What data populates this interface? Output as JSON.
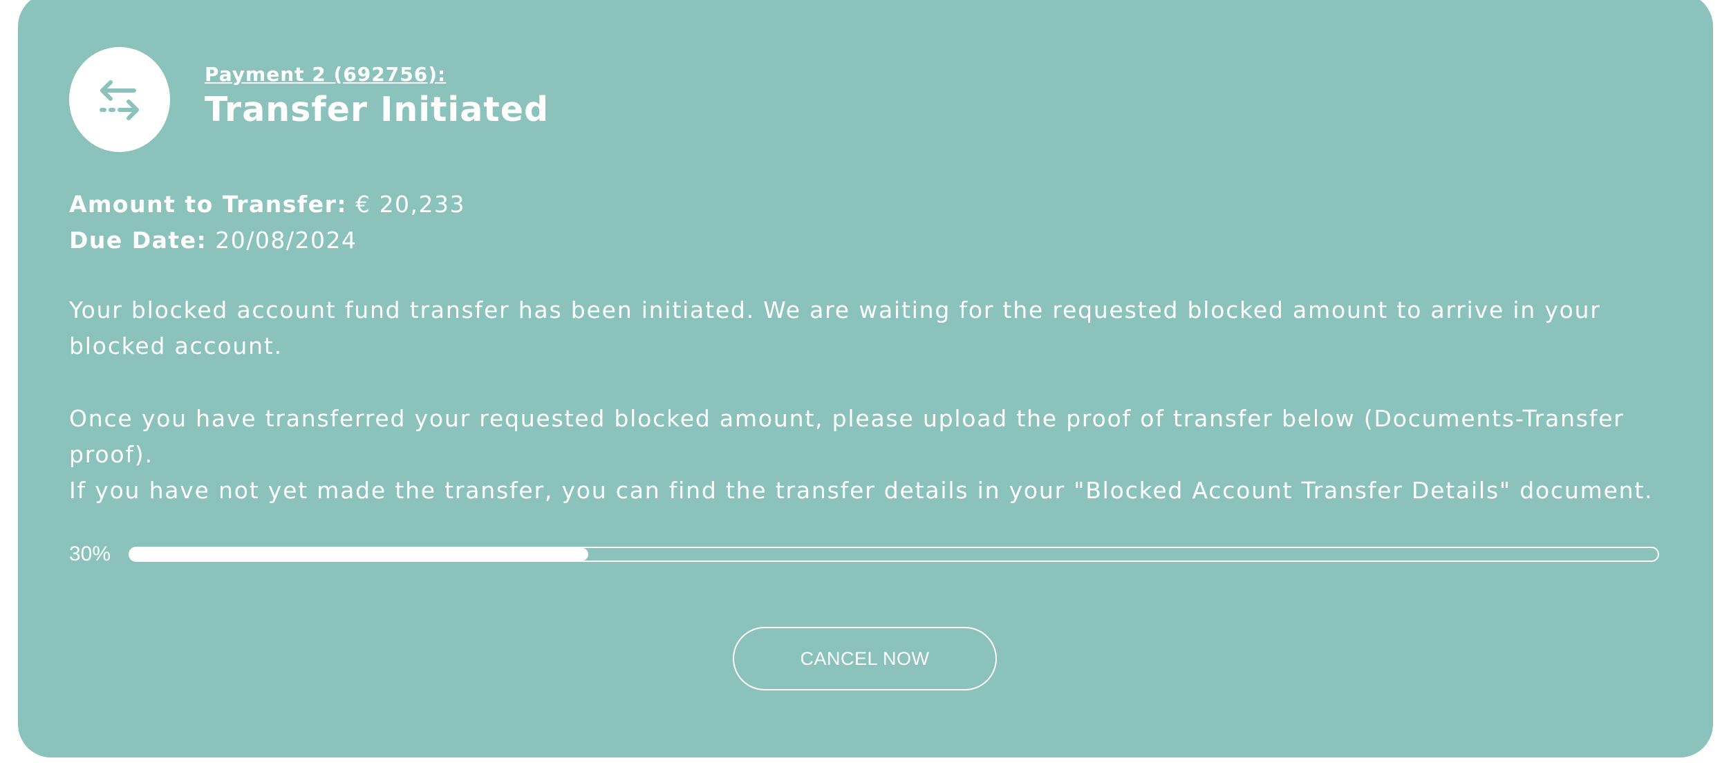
{
  "colors": {
    "card_background": "#8bc3bc",
    "text": "#ffffff",
    "icon": "#8bc3bc"
  },
  "header": {
    "icon": "transfer-arrows-icon",
    "payment_label": "Payment 2 (692756):",
    "title": "Transfer Initiated"
  },
  "details": {
    "amount_label": "Amount to Transfer:",
    "amount_value": "€ 20,233",
    "due_date_label": "Due Date:",
    "due_date_value": "20/08/2024"
  },
  "messages": {
    "p1": "Your blocked account fund transfer has been initiated. We are waiting for the requested blocked amount to arrive in your blocked account.",
    "p2": "Once you have transferred your requested blocked amount, please upload the proof of transfer below (Documents-Transfer proof).",
    "p3": "If you have not yet made the transfer, you can find the transfer details in your \"Blocked Account Transfer Details\" document."
  },
  "progress": {
    "label": "30%",
    "value": 0.3
  },
  "actions": {
    "cancel_label": "CANCEL NOW"
  }
}
